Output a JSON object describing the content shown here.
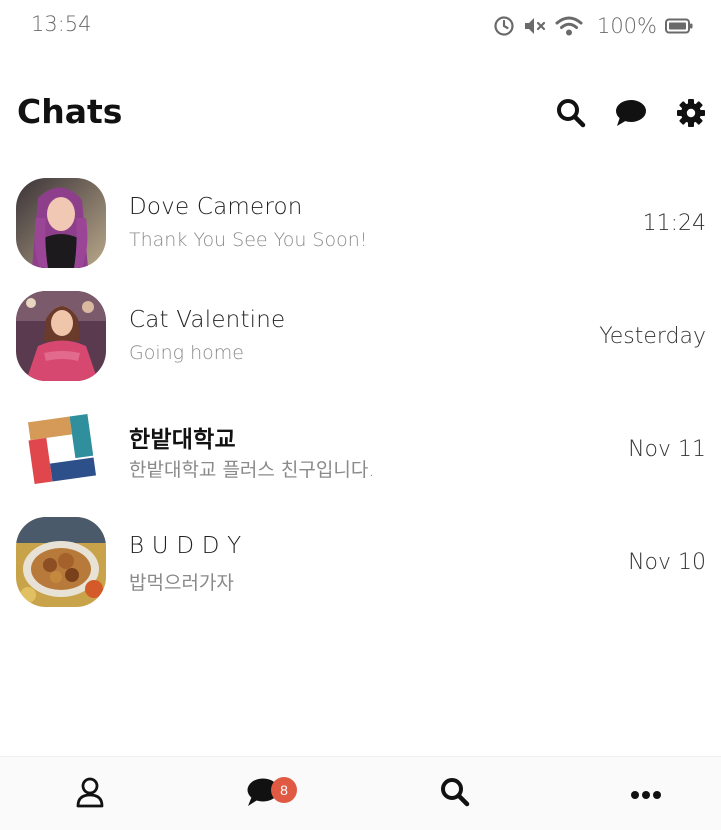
{
  "status_bar": {
    "time": "13:54",
    "battery": "100%",
    "icons": [
      "alarm-icon",
      "mute-icon",
      "wifi-icon",
      "battery-icon"
    ]
  },
  "header": {
    "title": "Chats",
    "actions": [
      "search-icon",
      "chat-bubble-icon",
      "gear-icon"
    ]
  },
  "chats": [
    {
      "name": "Dove Cameron",
      "preview": "Thank You See You Soon!",
      "time": "11:24",
      "avatar": "photo"
    },
    {
      "name": "Cat Valentine",
      "preview": "Going home",
      "time": "Yesterday",
      "avatar": "photo"
    },
    {
      "name": "한밭대학교",
      "preview": "한밭대학교 플러스 친구입니다.",
      "time": "Nov 11",
      "avatar": "logo"
    },
    {
      "name": "B U D D Y",
      "preview": "밥먹으러가자",
      "time": "Nov 10",
      "avatar": "photo"
    }
  ],
  "bottom_nav": {
    "items": [
      "person-icon",
      "chat-bubble-icon",
      "search-icon",
      "more-icon"
    ],
    "chat_badge": "8"
  },
  "colors": {
    "badge": "#e05a43",
    "text_primary": "#222222",
    "text_secondary": "#8a8a8a"
  }
}
